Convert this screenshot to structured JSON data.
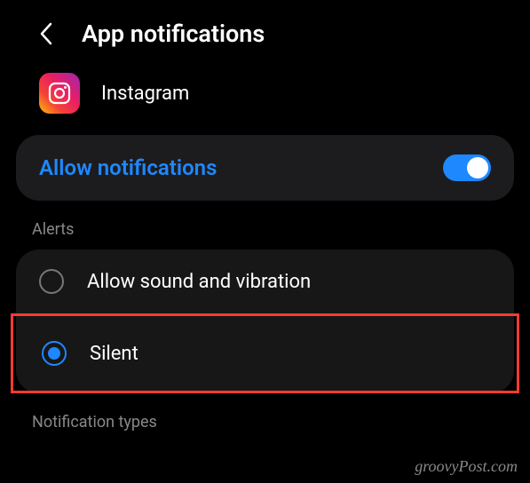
{
  "header": {
    "title": "App notifications"
  },
  "app": {
    "name": "Instagram"
  },
  "allow": {
    "label": "Allow notifications",
    "enabled": true
  },
  "sections": {
    "alerts_label": "Alerts",
    "notification_types_label": "Notification types"
  },
  "alerts": {
    "options": [
      {
        "label": "Allow sound and vibration",
        "selected": false
      },
      {
        "label": "Silent",
        "selected": true
      }
    ]
  },
  "watermark": "groovyPost.com"
}
